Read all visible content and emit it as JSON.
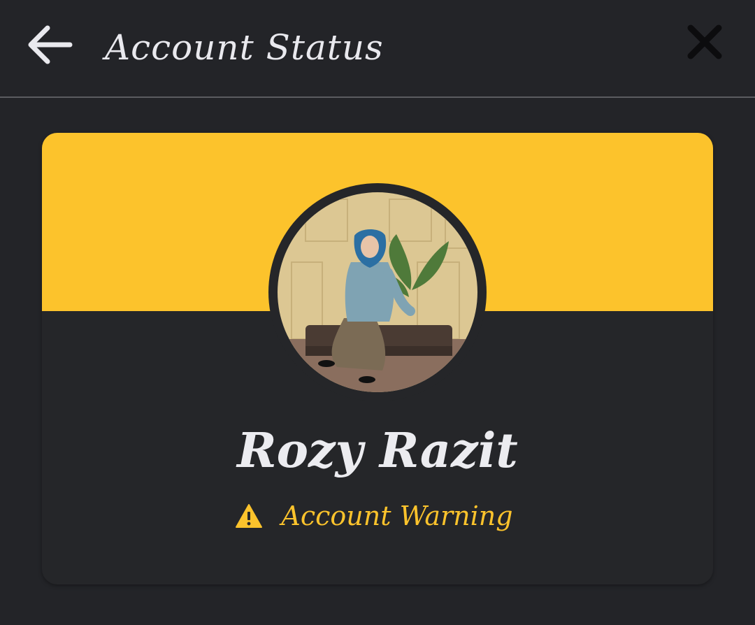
{
  "header": {
    "title": "Account Status",
    "back_icon": "arrow-left-icon",
    "close_icon": "close-icon"
  },
  "profile": {
    "name": "Rozy Razit",
    "status_icon": "warning-triangle-icon",
    "status_text": "Account Warning"
  },
  "colors": {
    "background": "#232428",
    "accent": "#fcc32c",
    "text": "#e9e9ee"
  }
}
